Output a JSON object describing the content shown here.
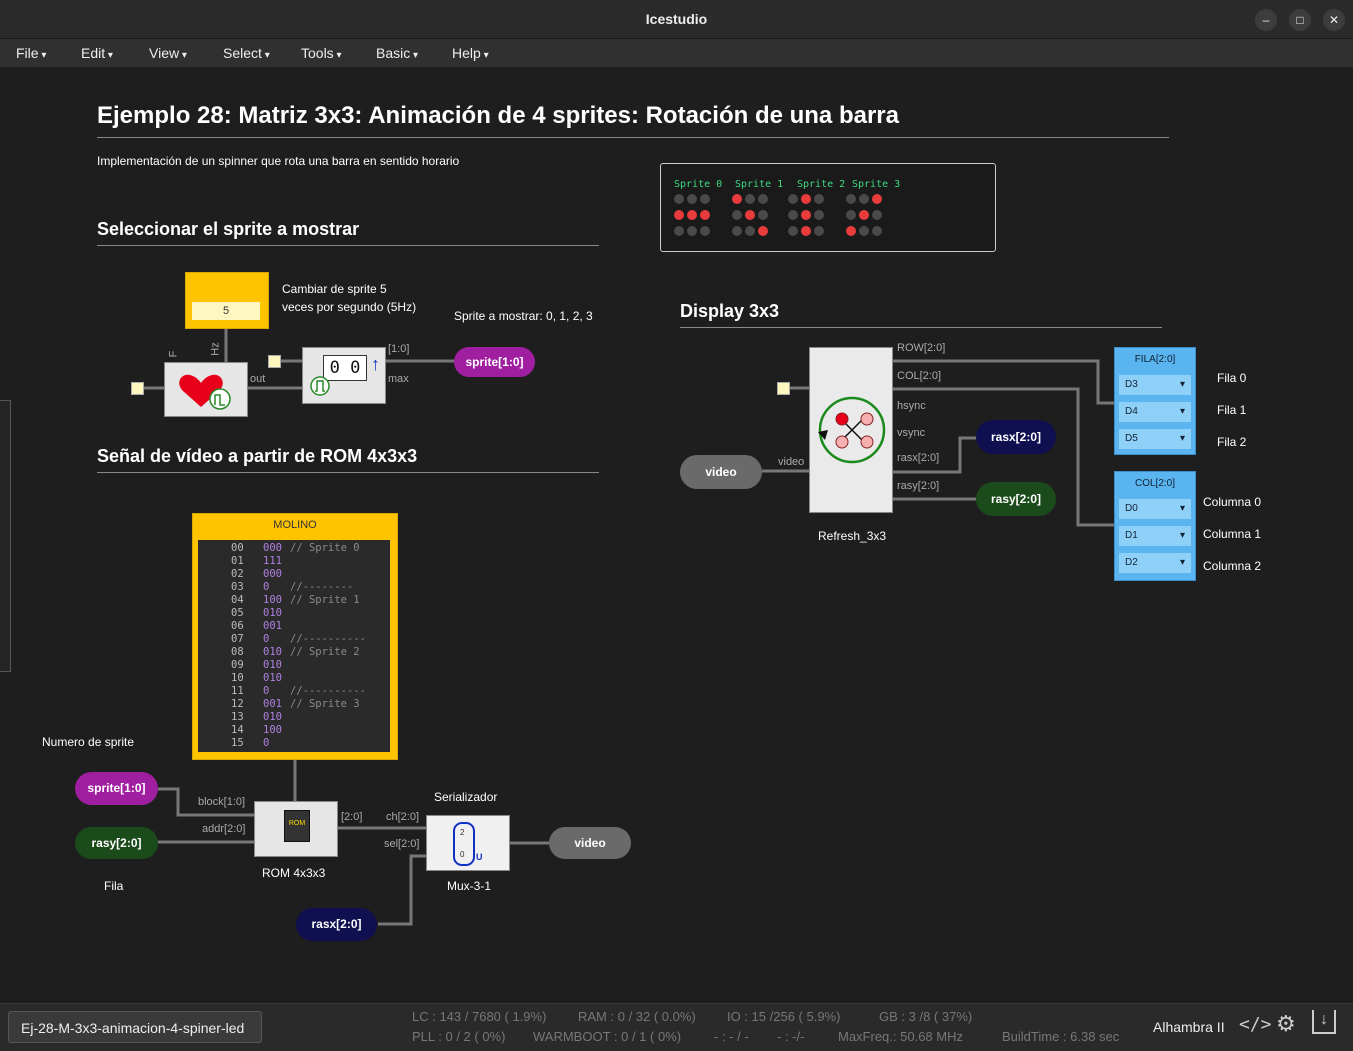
{
  "window": {
    "title": "Icestudio"
  },
  "menu": [
    "File",
    "Edit",
    "View",
    "Select",
    "Tools",
    "Basic",
    "Help"
  ],
  "doc": {
    "title": "Ejemplo 28: Matriz 3x3: Animación de 4 sprites: Rotación de una barra",
    "subtitle": "Implementación de un spinner que rota una barra en sentido horario",
    "sec1": "Seleccionar el sprite a mostrar",
    "sec2": "Señal de vídeo a partir de ROM 4x3x3",
    "sec3": "Display 3x3"
  },
  "sprites": {
    "labels": [
      "Sprite 0",
      "Sprite 1",
      "Sprite 2",
      "Sprite 3"
    ],
    "patterns": [
      [
        0,
        0,
        0,
        1,
        1,
        1,
        0,
        0,
        0
      ],
      [
        1,
        0,
        0,
        0,
        1,
        0,
        0,
        0,
        1
      ],
      [
        0,
        1,
        0,
        0,
        1,
        0,
        0,
        1,
        0
      ],
      [
        0,
        0,
        1,
        0,
        1,
        0,
        1,
        0,
        0
      ]
    ]
  },
  "sel": {
    "const_value": "5",
    "note1": "Cambiar de sprite 5",
    "note2": "veces por segundo (5Hz)",
    "note3": "Sprite a mostrar: 0, 1, 2, 3",
    "pin_f": "F",
    "pin_hz": "Hz",
    "pin_out": "out",
    "pin_bus": "[1:0]",
    "pin_max": "max",
    "counter": "0 0",
    "out_label": "sprite[1:0]"
  },
  "rom": {
    "title": "MOLINO",
    "rows": [
      {
        "a": "00",
        "v": "000",
        "c": "// Sprite 0"
      },
      {
        "a": "01",
        "v": "111",
        "c": ""
      },
      {
        "a": "02",
        "v": "000",
        "c": ""
      },
      {
        "a": "03",
        "v": "0",
        "c": "//--------"
      },
      {
        "a": "04",
        "v": "100",
        "c": "// Sprite 1"
      },
      {
        "a": "05",
        "v": "010",
        "c": ""
      },
      {
        "a": "06",
        "v": "001",
        "c": ""
      },
      {
        "a": "07",
        "v": "0",
        "c": "//----------"
      },
      {
        "a": "08",
        "v": "010",
        "c": "// Sprite 2"
      },
      {
        "a": "09",
        "v": "010",
        "c": ""
      },
      {
        "a": "10",
        "v": "010",
        "c": ""
      },
      {
        "a": "11",
        "v": "0",
        "c": "//----------"
      },
      {
        "a": "12",
        "v": "001",
        "c": "// Sprite 3"
      },
      {
        "a": "13",
        "v": "010",
        "c": ""
      },
      {
        "a": "14",
        "v": "100",
        "c": ""
      },
      {
        "a": "15",
        "v": "0",
        "c": ""
      }
    ],
    "numero": "Numero de sprite",
    "in_sprite": "sprite[1:0]",
    "in_rasy": "rasy[2:0]",
    "fila": "Fila",
    "pin_block": "block[1:0]",
    "pin_addr": "addr[2:0]",
    "pin_out": "[2:0]",
    "rom_label": "ROM 4x3x3",
    "serial": "Serializador",
    "pin_ch": "ch[2:0]",
    "pin_sel": "sel[2:0]",
    "mux_label": "Mux-3-1",
    "mux_2": "2",
    "mux_0": "0",
    "mux_u": "U",
    "video_out": "video",
    "rasx_in": "rasx[2:0]"
  },
  "disp": {
    "video_in": "video",
    "pin_video": "video",
    "pin_row": "ROW[2:0]",
    "pin_col": "COL[2:0]",
    "pin_hsync": "hsync",
    "pin_vsync": "vsync",
    "pin_rasx": "rasx[2:0]",
    "pin_rasy": "rasy[2:0]",
    "rasx_out": "rasx[2:0]",
    "rasy_out": "rasy[2:0]",
    "block_label": "Refresh_3x3",
    "fila": {
      "title": "FILA[2:0]",
      "opts": [
        "D3",
        "D4",
        "D5"
      ],
      "labels": [
        "Fila 0",
        "Fila 1",
        "Fila 2"
      ]
    },
    "col": {
      "title": "COL[2:0]",
      "opts": [
        "D0",
        "D1",
        "D2"
      ],
      "labels": [
        "Columna 0",
        "Columna 1",
        "Columna 2"
      ]
    }
  },
  "status": {
    "file": "Ej-28-M-3x3-animacion-4-spiner-led",
    "lc": "LC : 143 / 7680 ( 1.9%)",
    "ram": "RAM : 0 / 32 ( 0.0%)",
    "io": "IO :  15 /256  ( 5.9%)",
    "gb": "GB :  3 /8  ( 37%)",
    "pll": "PLL : 0 / 2 ( 0%)",
    "warm": "WARMBOOT : 0 / 1 ( 0%)",
    "dash1": "- : - / -",
    "dash2": "- :  -/-",
    "maxf": "MaxFreq.:  50.68 MHz",
    "build": "BuildTime :  6.38 sec",
    "board": "Alhambra II"
  }
}
